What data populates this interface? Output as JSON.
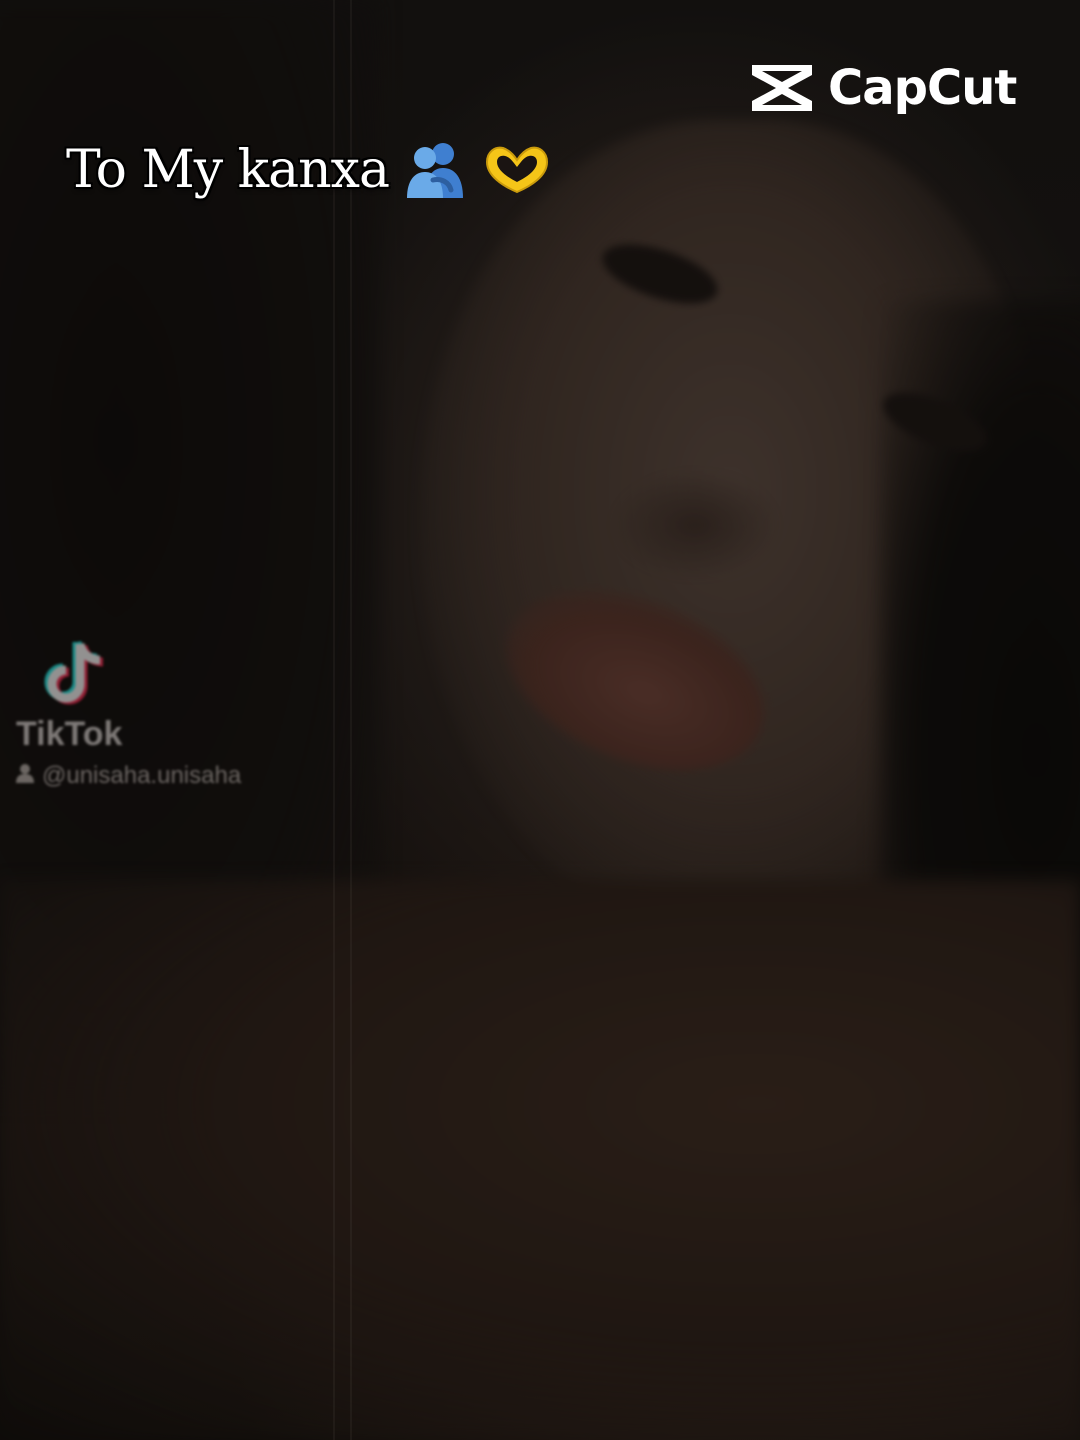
{
  "brand": {
    "name": "CapCut",
    "icon": "capcut-logo-icon",
    "color": "#ffffff"
  },
  "caption": {
    "text": "To My kanxa",
    "emojis": [
      "people-hugging-emoji",
      "heart-hands-emoji"
    ]
  },
  "watermark": {
    "platform": "TikTok",
    "icon": "tiktok-note-icon",
    "username": "@unisaha.unisaha"
  },
  "colors": {
    "tiktok_cyan": "#25f4ee",
    "tiktok_red": "#fe2c55",
    "emoji_blue": "#4a90d9",
    "emoji_yellow": "#f5c518"
  }
}
